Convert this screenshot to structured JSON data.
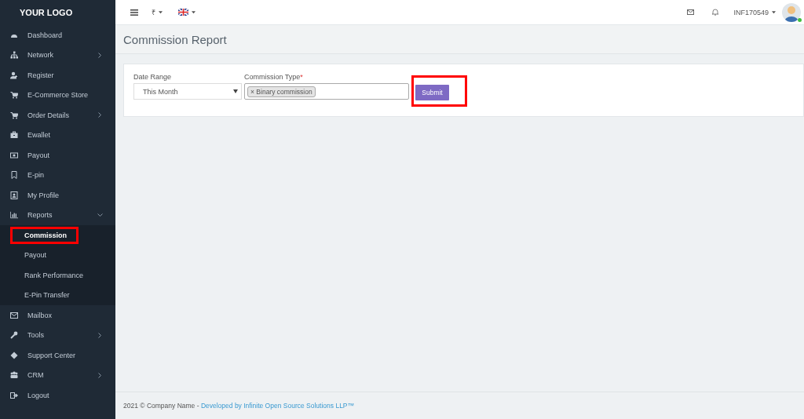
{
  "sidebar": {
    "logo": "YOUR LOGO",
    "items": [
      {
        "label": "Dashboard"
      },
      {
        "label": "Network",
        "expanded": false
      },
      {
        "label": "Register"
      },
      {
        "label": "E-Commerce Store"
      },
      {
        "label": "Order Details",
        "expanded": false
      },
      {
        "label": "Ewallet"
      },
      {
        "label": "Payout"
      },
      {
        "label": "E-pin"
      },
      {
        "label": "My Profile"
      },
      {
        "label": "Reports",
        "expanded": true,
        "children": [
          {
            "label": "Commission",
            "selected": true,
            "highlighted": true
          },
          {
            "label": "Payout",
            "selected": false,
            "highlighted": false
          },
          {
            "label": "Rank Performance",
            "selected": false,
            "highlighted": false
          },
          {
            "label": "E-Pin Transfer",
            "selected": false,
            "highlighted": false
          }
        ]
      },
      {
        "label": "Mailbox"
      },
      {
        "label": "Tools",
        "expanded": false
      },
      {
        "label": "Support Center"
      },
      {
        "label": "CRM",
        "expanded": false
      },
      {
        "label": "Logout"
      }
    ]
  },
  "topbar": {
    "currency": "₹",
    "user": "INF170549",
    "online": true
  },
  "page_title": "Commission Report",
  "form": {
    "date_range": {
      "label": "Date Range",
      "value": "This Month"
    },
    "commission_type": {
      "label": "Commission Type",
      "required_mark": "*",
      "tags": [
        {
          "remove": "×",
          "label": "Binary commission"
        }
      ]
    },
    "submit": {
      "label": "Submit",
      "highlighted": true
    }
  },
  "footer": {
    "text": "2021 © Company Name - ",
    "link": "Developed by Infinite Open Source Solutions LLP™"
  }
}
